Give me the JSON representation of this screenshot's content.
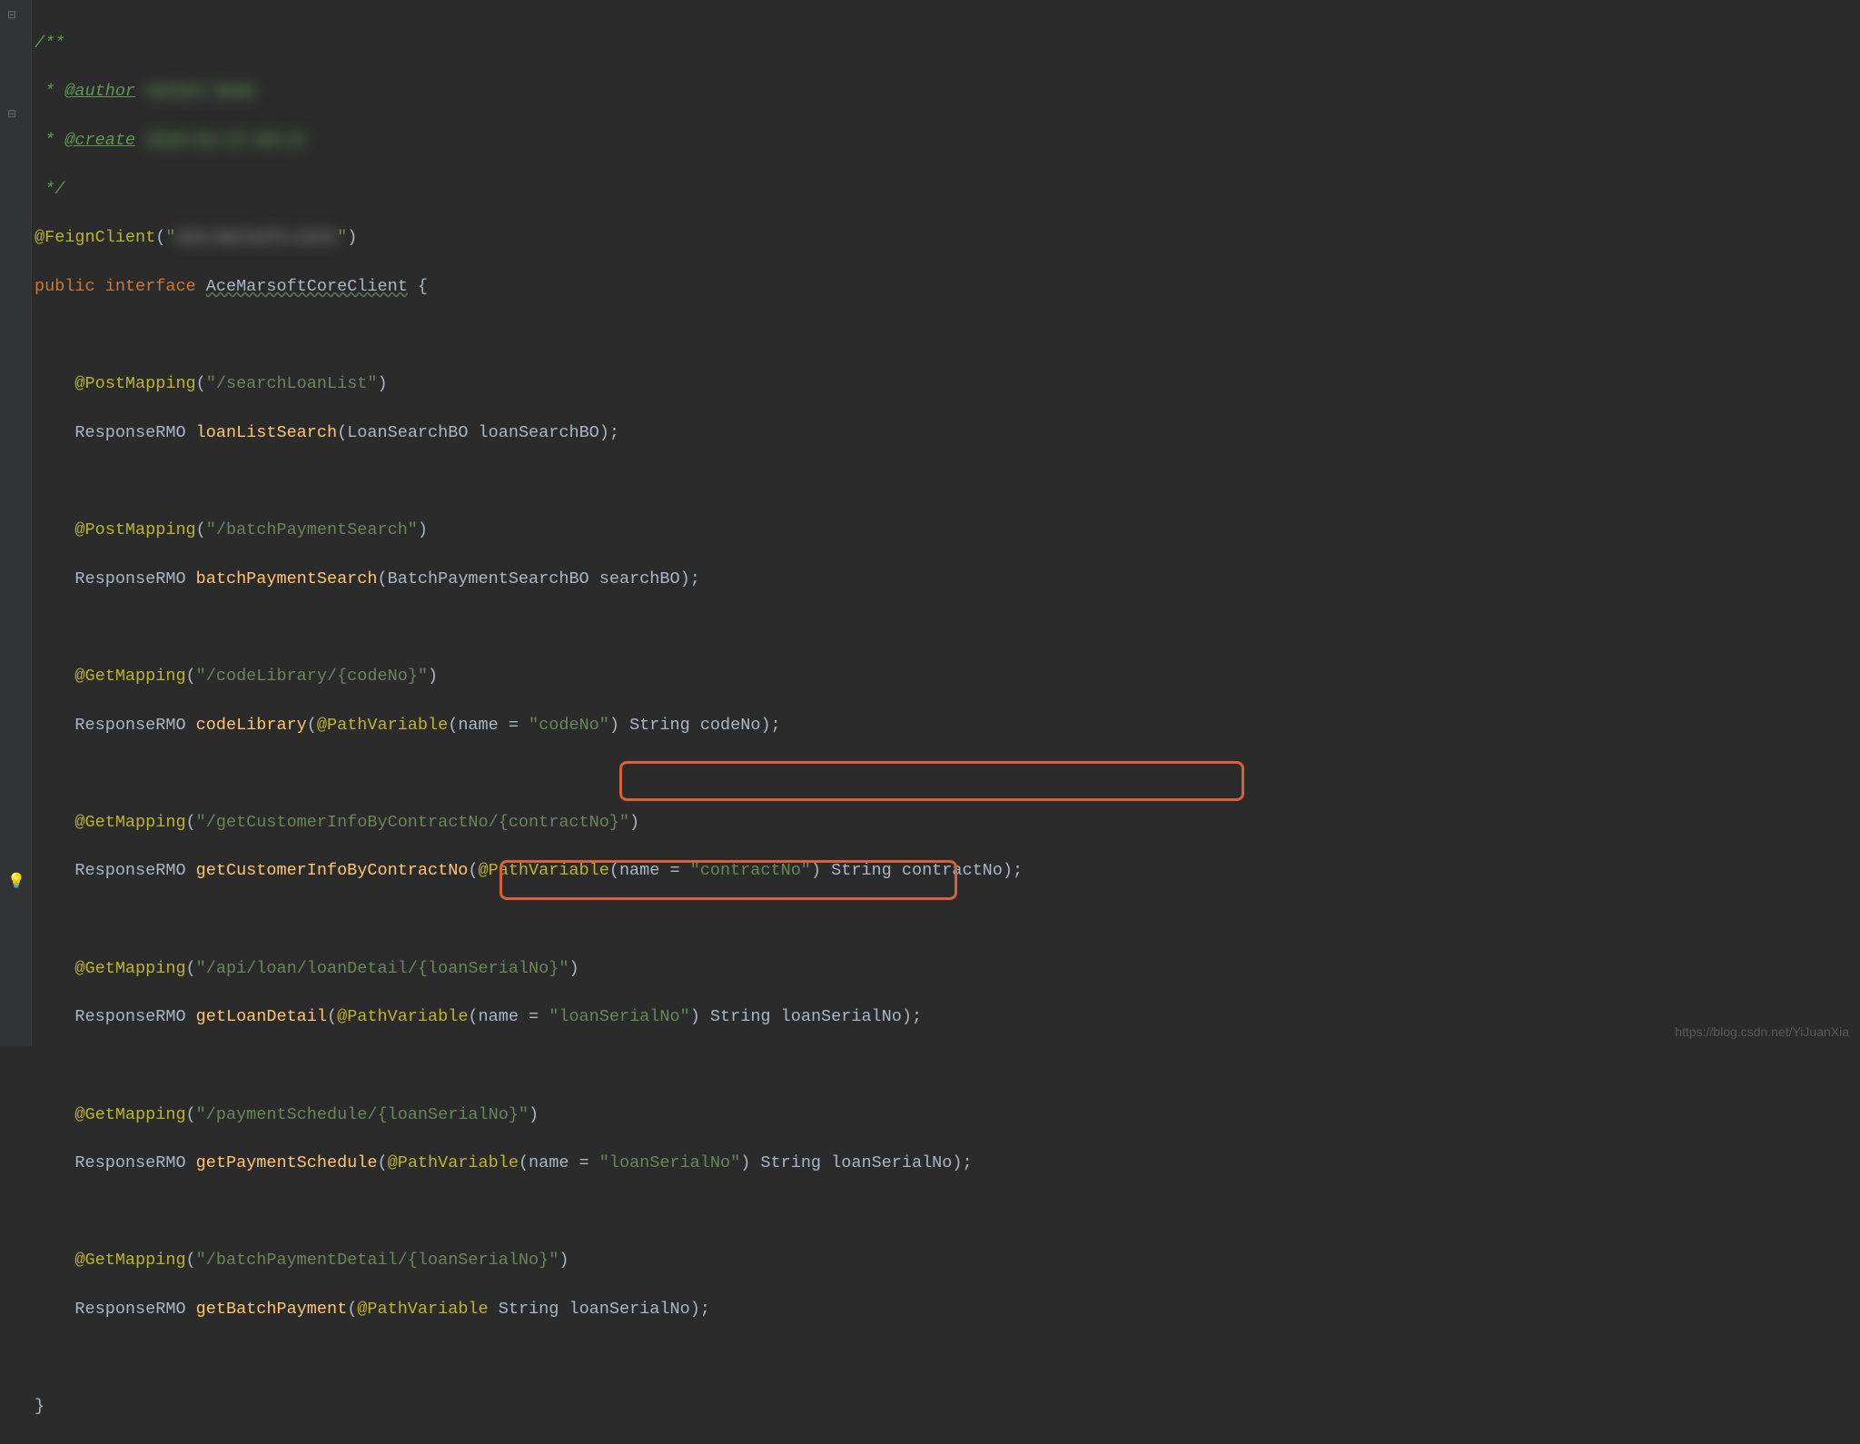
{
  "doc_open": "/**",
  "doc_star": " * ",
  "doc_author_tag": "@author",
  "doc_author_blur": "Author Name",
  "doc_create_tag": "@create",
  "doc_create_blur": "2018-01-17 09:17",
  "doc_close": " */",
  "feign_annotation": "@FeignClient",
  "feign_open": "(",
  "feign_quote": "\"",
  "feign_value_blur": "ace-marsoft-core",
  "feign_close": ")",
  "interface_public": "public",
  "interface_keyword": "interface",
  "interface_name": "AceMarsoftCoreClient",
  "brace_open": " {",
  "brace_close": "}",
  "post_mapping": "@PostMapping",
  "get_mapping": "@GetMapping",
  "path_variable": "@PathVariable",
  "m1_path": "\"/searchLoanList\"",
  "m1_return": "ResponseRMO",
  "m1_name": "loanListSearch",
  "m1_param_type": "LoanSearchBO",
  "m1_param_name": "loanSearchBO",
  "m2_path": "\"/batchPaymentSearch\"",
  "m2_return": "ResponseRMO",
  "m2_name": "batchPaymentSearch",
  "m2_param_type": "BatchPaymentSearchBO",
  "m2_param_name": "searchBO",
  "m3_path": "\"/codeLibrary/{codeNo}\"",
  "m3_return": "ResponseRMO",
  "m3_name": "codeLibrary",
  "m3_pv_name": "name = ",
  "m3_pv_value": "\"codeNo\"",
  "m3_param_type": "String",
  "m3_param_name": "codeNo",
  "m4_path": "\"/getCustomerInfoByContractNo/{contractNo}\"",
  "m4_return": "ResponseRMO",
  "m4_name": "getCustomerInfoByContractNo",
  "m4_pv_name": "name = ",
  "m4_pv_value": "\"contractNo\"",
  "m4_param_type": "String",
  "m4_param_name": "contractNo",
  "m5_path": "\"/api/loan/loanDetail/{loanSerialNo}\"",
  "m5_return": "ResponseRMO",
  "m5_name": "getLoanDetail",
  "m5_pv_name": "name = ",
  "m5_pv_value": "\"loanSerialNo\"",
  "m5_param_type": "String",
  "m5_param_name": "loanSerialNo",
  "m6_path": "\"/paymentSchedule/{loanSerialNo}\"",
  "m6_return": "ResponseRMO",
  "m6_name": "getPaymentSchedule",
  "m6_pv_name": "name = ",
  "m6_pv_value": "\"loanSerialNo\"",
  "m6_param_type": "String",
  "m6_param_name": "loanSerialNo",
  "m7_path": "\"/batchPaymentDetail/{loanSerialNo}\"",
  "m7_return": "ResponseRMO",
  "m7_name": "getBatchPayment",
  "m7_param_type": "String",
  "m7_param_name": "loanSerialNo",
  "watermark": "https://blog.csdn.net/YiJuanXia"
}
